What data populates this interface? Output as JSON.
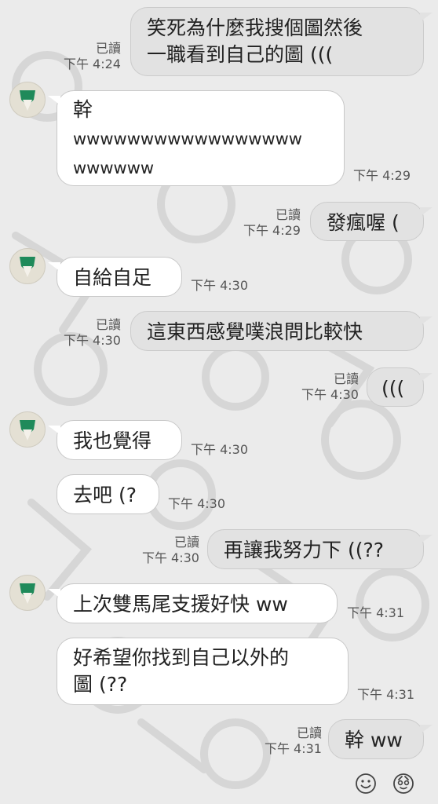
{
  "messages": [
    {
      "dir": "out",
      "text": "笑死為什麼我搜個圖然後\n一職看到自己的圖 (((",
      "read": "已讀",
      "time": "下午 4:24"
    },
    {
      "dir": "in",
      "text": "幹\nwwwwwwwwwwwwwwwww\nwwwwww",
      "time": "下午 4:29"
    },
    {
      "dir": "out",
      "text": "發瘋喔 (",
      "read": "已讀",
      "time": "下午 4:29"
    },
    {
      "dir": "in",
      "text": "自給自足",
      "time": "下午 4:30"
    },
    {
      "dir": "out",
      "text": "這東西感覺噗浪問比較快",
      "read": "已讀",
      "time": "下午 4:30"
    },
    {
      "dir": "out",
      "text": "(((",
      "read": "已讀",
      "time": "下午 4:30"
    },
    {
      "dir": "in",
      "text": "我也覺得",
      "time": "下午 4:30"
    },
    {
      "dir": "in",
      "text": "去吧 (?",
      "time": "下午 4:30"
    },
    {
      "dir": "out",
      "text": "再讓我努力下 ((??",
      "read": "已讀",
      "time": "下午 4:30"
    },
    {
      "dir": "in",
      "text": "上次雙馬尾支援好快 ww",
      "time": "下午 4:31"
    },
    {
      "dir": "in",
      "text": "好希望你找到自己以外的\n圖 (??",
      "time": "下午 4:31"
    },
    {
      "dir": "out",
      "text": "幹 ww",
      "read": "已讀",
      "time": "下午 4:31"
    }
  ],
  "toolbar": {
    "emoji_icon": "smiley-icon",
    "sticker_icon": "sticker-icon"
  },
  "colors": {
    "avatar_green": "#1f8a5a",
    "background": "#ebebeb"
  }
}
